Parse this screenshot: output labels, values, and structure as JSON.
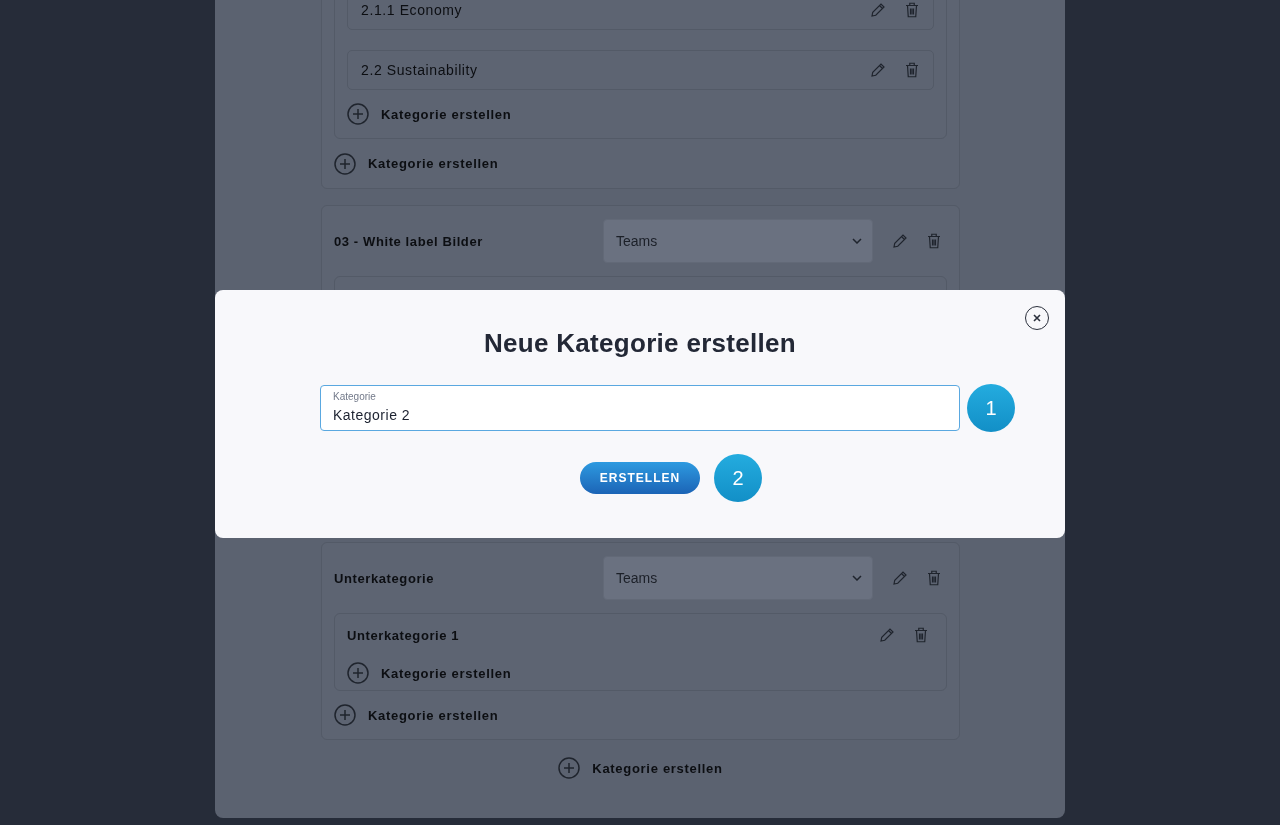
{
  "category_tree": {
    "groups": [
      {
        "kind": "partial",
        "children": [
          {
            "label": "2.1.1 Economy"
          },
          {
            "label": "2.2 Sustainability"
          }
        ],
        "inner_add": "Kategorie erstellen",
        "add": "Kategorie erstellen"
      },
      {
        "kind": "header",
        "title": "03 - White label Bilder",
        "select_placeholder": "Teams"
      },
      {
        "kind": "full",
        "title": "Unterkategorie",
        "select_placeholder": "Teams",
        "children": [
          {
            "label": "Unterkategorie 1",
            "add": "Kategorie erstellen"
          }
        ],
        "add": "Kategorie erstellen"
      }
    ],
    "add": "Kategorie erstellen"
  },
  "modal": {
    "title": "Neue Kategorie erstellen",
    "field": {
      "label": "Kategorie",
      "value": "Kategorie 2"
    },
    "field_step": "1",
    "button": "ERSTELLEN",
    "button_step": "2"
  }
}
